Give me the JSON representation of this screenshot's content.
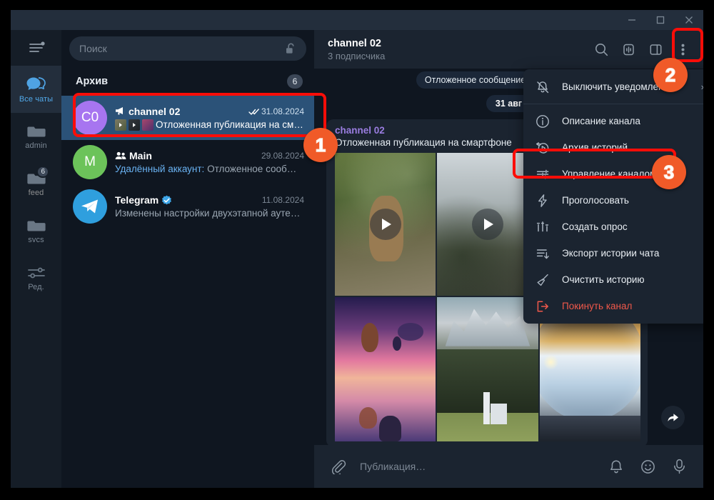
{
  "window": {
    "minimize_label": "Minimize",
    "maximize_label": "Maximize",
    "close_label": "Close"
  },
  "rail": {
    "menu_icon": "hamburger-menu-icon",
    "items": [
      {
        "label": "Все чаты",
        "icon": "chats-icon",
        "active": true,
        "badge": ""
      },
      {
        "label": "admin",
        "icon": "folder-icon",
        "active": false,
        "badge": ""
      },
      {
        "label": "feed",
        "icon": "folder-icon",
        "active": false,
        "badge": "6"
      },
      {
        "label": "svcs",
        "icon": "folder-icon",
        "active": false,
        "badge": ""
      },
      {
        "label": "Ред.",
        "icon": "sliders-icon",
        "active": false,
        "badge": ""
      }
    ]
  },
  "search": {
    "placeholder": "Поиск",
    "lock_icon": "unlock-icon"
  },
  "chatlist": {
    "archive_title": "Архив",
    "archive_count": "6",
    "items": [
      {
        "avatar_text": "C0",
        "avatar_color": "#a775f0",
        "name": "channel 02",
        "name_icon": "megaphone-icon",
        "date": "31.08.2024",
        "read_icon": "double-check-icon",
        "message": "Отложенная публикация на смар…",
        "sender": "",
        "selected": true,
        "thumbs": [
          "#6b6a5a",
          "#2b2f33",
          "#8d4b6b"
        ]
      },
      {
        "avatar_text": "M",
        "avatar_color": "#6cc35a",
        "name": "Main",
        "name_icon": "group-icon",
        "date": "29.08.2024",
        "read_icon": "",
        "message": "Отложенное сообщен…",
        "sender": "Удалённый аккаунт:",
        "selected": false,
        "thumbs": []
      },
      {
        "avatar_text": "",
        "avatar_color": "#2f9fde",
        "name": "Telegram",
        "name_icon": "verified-icon",
        "date": "11.08.2024",
        "read_icon": "",
        "message": "Изменены настройки двухэтапной аутент…",
        "sender": "",
        "selected": false,
        "thumbs": []
      }
    ]
  },
  "chat": {
    "title": "channel 02",
    "subtitle": "3 подписчика",
    "header_icons": [
      {
        "name": "search-icon"
      },
      {
        "name": "stories-archive-icon"
      },
      {
        "name": "split-view-icon"
      },
      {
        "name": "more-vertical-icon"
      }
    ],
    "service_message": "Отложенное сообщение, отправленно…",
    "date_divider": "31 авг",
    "message": {
      "author": "channel 02",
      "text": "Отложенная публикация на смартфоне",
      "media": [
        {
          "alt": "deer-photo",
          "type": "video"
        },
        {
          "alt": "foggy-road-photo",
          "type": "video"
        },
        {
          "alt": "hidden-photo",
          "type": "photo"
        },
        {
          "alt": "hot-air-balloons-sunset-photo",
          "type": "photo"
        },
        {
          "alt": "mountain-church-photo",
          "type": "photo"
        },
        {
          "alt": "glass-sphere-sunset-photo",
          "type": "photo"
        }
      ],
      "forward_icon": "forward-arrow-icon"
    }
  },
  "composer": {
    "attach_icon": "paperclip-icon",
    "placeholder": "Публикация…",
    "icons": [
      {
        "name": "bell-icon"
      },
      {
        "name": "emoji-icon"
      },
      {
        "name": "microphone-icon"
      }
    ]
  },
  "context_menu": {
    "items": [
      {
        "label": "Выключить уведомлен…",
        "icon": "mute-bell-icon",
        "submenu": "›",
        "danger": false,
        "separator_after": true
      },
      {
        "label": "Описание канала",
        "icon": "info-circle-icon",
        "submenu": "",
        "danger": false,
        "separator_after": false
      },
      {
        "label": "Архив историй",
        "icon": "stories-archive-icon",
        "submenu": "",
        "danger": false,
        "separator_after": false
      },
      {
        "label": "Управление каналом",
        "icon": "sliders-icon",
        "submenu": "",
        "danger": false,
        "separator_after": false
      },
      {
        "label": "Проголосовать",
        "icon": "boost-icon",
        "submenu": "",
        "danger": false,
        "separator_after": false
      },
      {
        "label": "Создать опрос",
        "icon": "poll-icon",
        "submenu": "",
        "danger": false,
        "separator_after": false
      },
      {
        "label": "Экспорт истории чата",
        "icon": "export-icon",
        "submenu": "",
        "danger": false,
        "separator_after": false
      },
      {
        "label": "Очистить историю",
        "icon": "broom-icon",
        "submenu": "",
        "danger": false,
        "separator_after": false
      },
      {
        "label": "Покинуть канал",
        "icon": "leave-icon",
        "submenu": "",
        "danger": true,
        "separator_after": false
      }
    ]
  },
  "annotations": {
    "highlight_color": "#fb0d08",
    "badge_color": "#f05a28",
    "callouts": [
      {
        "number": "1"
      },
      {
        "number": "2"
      },
      {
        "number": "3"
      }
    ]
  }
}
